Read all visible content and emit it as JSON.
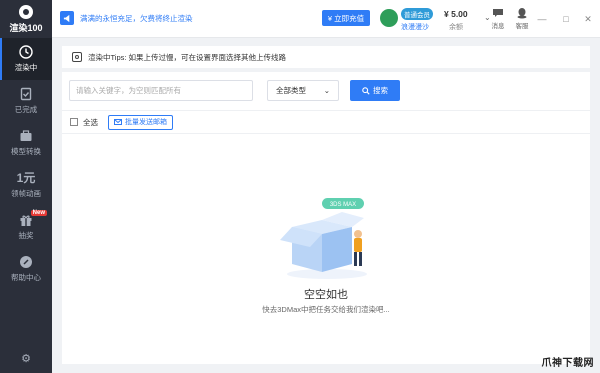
{
  "app": {
    "name": "渲染100"
  },
  "sidebar": {
    "items": [
      {
        "label": "渲染中",
        "icon": "render-icon",
        "active": true
      },
      {
        "label": "已完成",
        "icon": "done-icon"
      },
      {
        "label": "模型转换",
        "icon": "convert-icon"
      },
      {
        "label": "领帧动画",
        "icon": "yuan-icon",
        "glyph": "1元"
      },
      {
        "label": "抽奖",
        "icon": "gift-icon",
        "badge": "New"
      },
      {
        "label": "帮助中心",
        "icon": "help-icon"
      }
    ],
    "settings_icon": "gear-icon"
  },
  "topbar": {
    "notice": "满满的永恒充足，欠费将终止渲染",
    "recharge_label": "¥ 立即充值",
    "member_badge": "普通会员",
    "user_name": "浪漫漫沙",
    "balance_value": "¥ 5.00",
    "balance_label": "余额",
    "message_label": "消息",
    "service_label": "客服"
  },
  "tips": {
    "text": "渲染中Tips: 如果上传过慢，可在设置界面选择其他上传线路"
  },
  "search": {
    "placeholder": "请输入关键字，为空则匹配所有",
    "type_value": "全部类型",
    "button_label": "搜索"
  },
  "toolbar": {
    "select_all_label": "全选",
    "email_button_label": "批量发送邮箱"
  },
  "empty_state": {
    "badge_text": "3DS MAX",
    "title": "空空如也",
    "subtitle": "快去3DMax中把任务交给我们渲染吧..."
  },
  "watermark": "爪神下载网",
  "colors": {
    "accent": "#2f7cf6",
    "sidebar": "#2b2f3a",
    "badge_red": "#e53935"
  }
}
